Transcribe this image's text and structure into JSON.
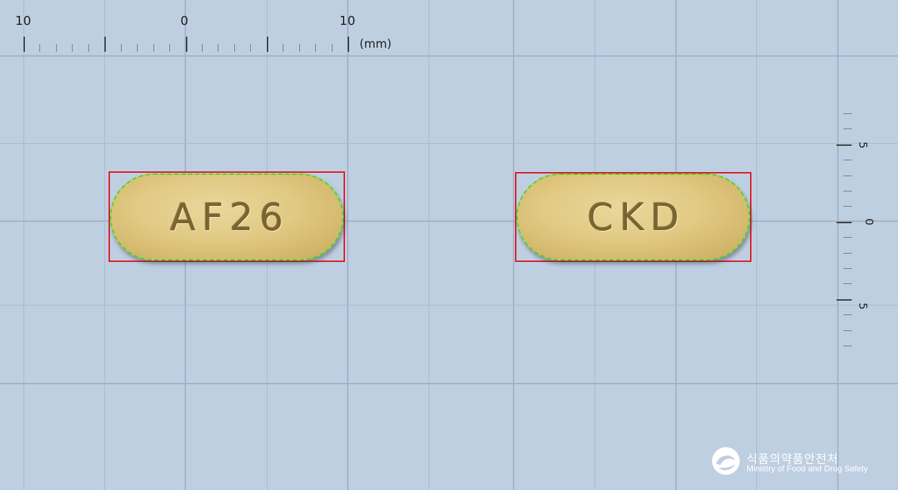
{
  "top_ruler": {
    "labels": [
      "10",
      "0",
      "10"
    ],
    "unit": "(mm)"
  },
  "side_ruler": {
    "labels": [
      "5",
      "0",
      "5"
    ]
  },
  "tablets": [
    {
      "imprint": "AF26",
      "color": "#e1c983"
    },
    {
      "imprint": "CKD",
      "color": "#e1c983"
    }
  ],
  "outline_colors": {
    "bounding_box": "#e0141c",
    "contour": "#38e01c"
  },
  "logo": {
    "korean": "식품의약품안전처",
    "english": "Ministry of Food and Drug Safety"
  }
}
